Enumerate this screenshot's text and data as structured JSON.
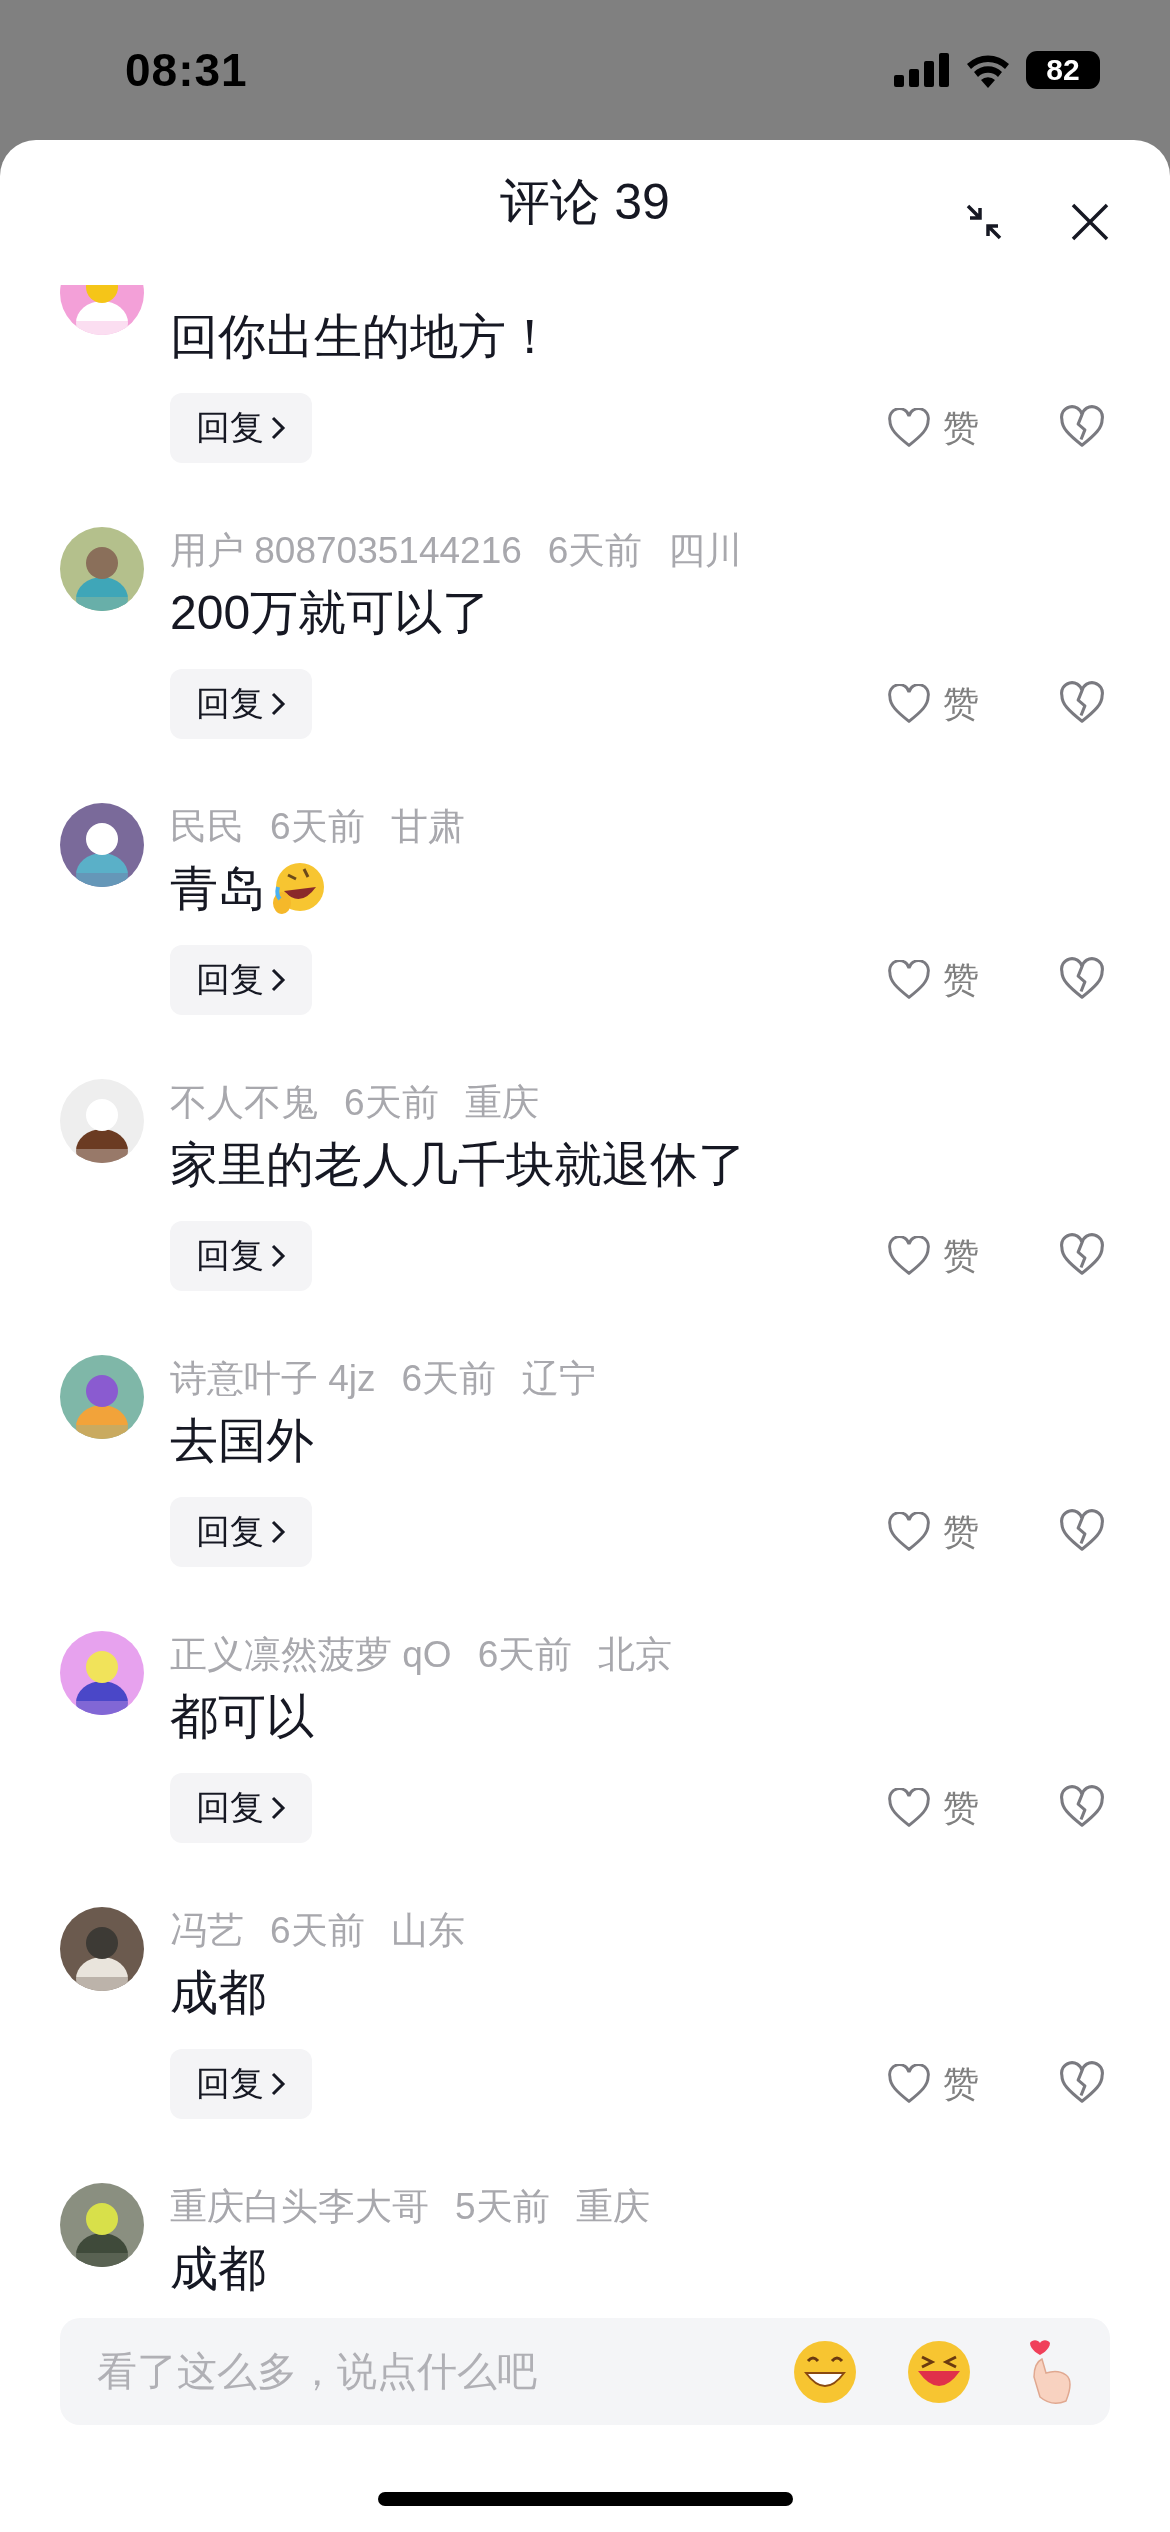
{
  "status_bar": {
    "time": "08:31",
    "battery": "82"
  },
  "header": {
    "title": "评论 39"
  },
  "comments": [
    {
      "text": "回你出生的地方！",
      "reply": "回复",
      "like": "赞"
    },
    {
      "user": "用户 8087035144216",
      "time": "6天前",
      "location": "四川",
      "text": "200万就可以了",
      "reply": "回复",
      "like": "赞"
    },
    {
      "user": "民民",
      "time": "6天前",
      "location": "甘肃",
      "text": "青岛",
      "emoji": true,
      "reply": "回复",
      "like": "赞"
    },
    {
      "user": "不人不鬼",
      "time": "6天前",
      "location": "重庆",
      "text": "家里的老人几千块就退休了",
      "reply": "回复",
      "like": "赞"
    },
    {
      "user": "诗意叶子 4jz",
      "time": "6天前",
      "location": "辽宁",
      "text": "去国外",
      "reply": "回复",
      "like": "赞"
    },
    {
      "user": "正义凛然菠萝 qO",
      "time": "6天前",
      "location": "北京",
      "text": "都可以",
      "reply": "回复",
      "like": "赞"
    },
    {
      "user": "冯艺",
      "time": "6天前",
      "location": "山东",
      "text": "成都",
      "reply": "回复",
      "like": "赞"
    },
    {
      "user": "重庆白头李大哥",
      "time": "5天前",
      "location": "重庆",
      "text": "成都"
    }
  ],
  "input": {
    "placeholder": "看了这么多，说点什么吧"
  }
}
